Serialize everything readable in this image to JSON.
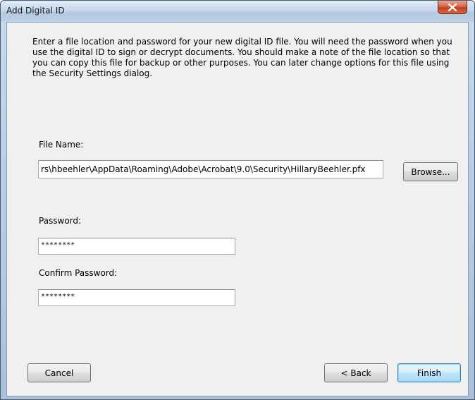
{
  "window": {
    "title": "Add Digital ID"
  },
  "instructions": "Enter a file location and password for your new digital ID file. You will need the password when you use the digital ID to sign or decrypt documents. You should make a note of the file location so that you can copy this file for backup or other purposes. You can later change options for this file using the Security Settings dialog.",
  "file_name": {
    "label": "File Name:",
    "value": "rs\\hbeehler\\AppData\\Roaming\\Adobe\\Acrobat\\9.0\\Security\\HillaryBeehler.pfx",
    "browse_label": "Browse..."
  },
  "password": {
    "label": "Password:",
    "value": "********"
  },
  "confirm_password": {
    "label": "Confirm Password:",
    "value": "********"
  },
  "buttons": {
    "cancel": "Cancel",
    "back": "< Back",
    "finish": "Finish"
  },
  "icons": {
    "close": "close-x-icon"
  },
  "colors": {
    "close_button": "#c8452a",
    "default_button_border": "#3c7fb1"
  }
}
